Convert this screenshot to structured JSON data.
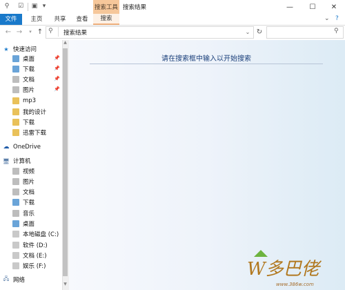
{
  "titlebar": {
    "context_group": "搜索工具",
    "title": "搜索结果",
    "minimize": "—",
    "maximize": "☐",
    "close": "✕"
  },
  "tabs": {
    "file": "文件",
    "home": "主页",
    "share": "共享",
    "view": "查看",
    "search": "搜索"
  },
  "address": {
    "path": "搜索结果",
    "search_placeholder": ""
  },
  "nav": {
    "quick_access": {
      "label": "快速访问",
      "items": [
        {
          "label": "桌面",
          "pinned": true
        },
        {
          "label": "下载",
          "pinned": true
        },
        {
          "label": "文档",
          "pinned": true
        },
        {
          "label": "图片",
          "pinned": true
        },
        {
          "label": "mp3",
          "pinned": false
        },
        {
          "label": "我的设计",
          "pinned": false
        },
        {
          "label": "下载",
          "pinned": false
        },
        {
          "label": "迅雷下载",
          "pinned": false
        }
      ]
    },
    "onedrive": "OneDrive",
    "computer": {
      "label": "计算机",
      "items": [
        {
          "label": "视频"
        },
        {
          "label": "图片"
        },
        {
          "label": "文档"
        },
        {
          "label": "下载"
        },
        {
          "label": "音乐"
        },
        {
          "label": "桌面"
        },
        {
          "label": "本地磁盘 (C:)"
        },
        {
          "label": "软件 (D:)"
        },
        {
          "label": "文档 (E:)"
        },
        {
          "label": "娱乐 (F:)"
        }
      ]
    },
    "network": "网络"
  },
  "content": {
    "message": "请在搜索框中输入以开始搜索"
  },
  "watermark": {
    "logo_text": "W多巴佬",
    "url": "www.386w.com"
  },
  "colors": {
    "file_tab": "#1979ca",
    "context_tab": "#f6c79a",
    "content_text": "#1a3f7a"
  }
}
